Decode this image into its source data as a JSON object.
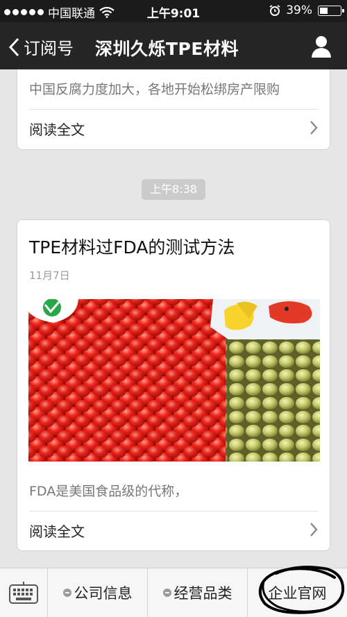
{
  "status_bar": {
    "carrier": "中国联通",
    "time": "上午9:01",
    "battery": "39%",
    "battery_level": 0.39
  },
  "nav": {
    "back_label": "订阅号",
    "title": "深圳久烁TPE材料"
  },
  "articles": [
    {
      "excerpt": "中国反腐力度加大，各地开始松绑房产限购",
      "read_more": "阅读全文"
    },
    {
      "timestamp": "上午8:38",
      "title": "TPE材料过FDA的测试方法",
      "date": "11月7日",
      "excerpt": "FDA是美国食品级的代称，",
      "read_more": "阅读全文"
    }
  ],
  "menu": {
    "items": [
      "公司信息",
      "经营品类",
      "企业官网"
    ]
  },
  "icons": {
    "back": "chevron-left-icon",
    "profile": "person-icon",
    "keyboard": "keyboard-icon",
    "wifi": "wifi-icon",
    "alarm": "alarm-icon"
  }
}
